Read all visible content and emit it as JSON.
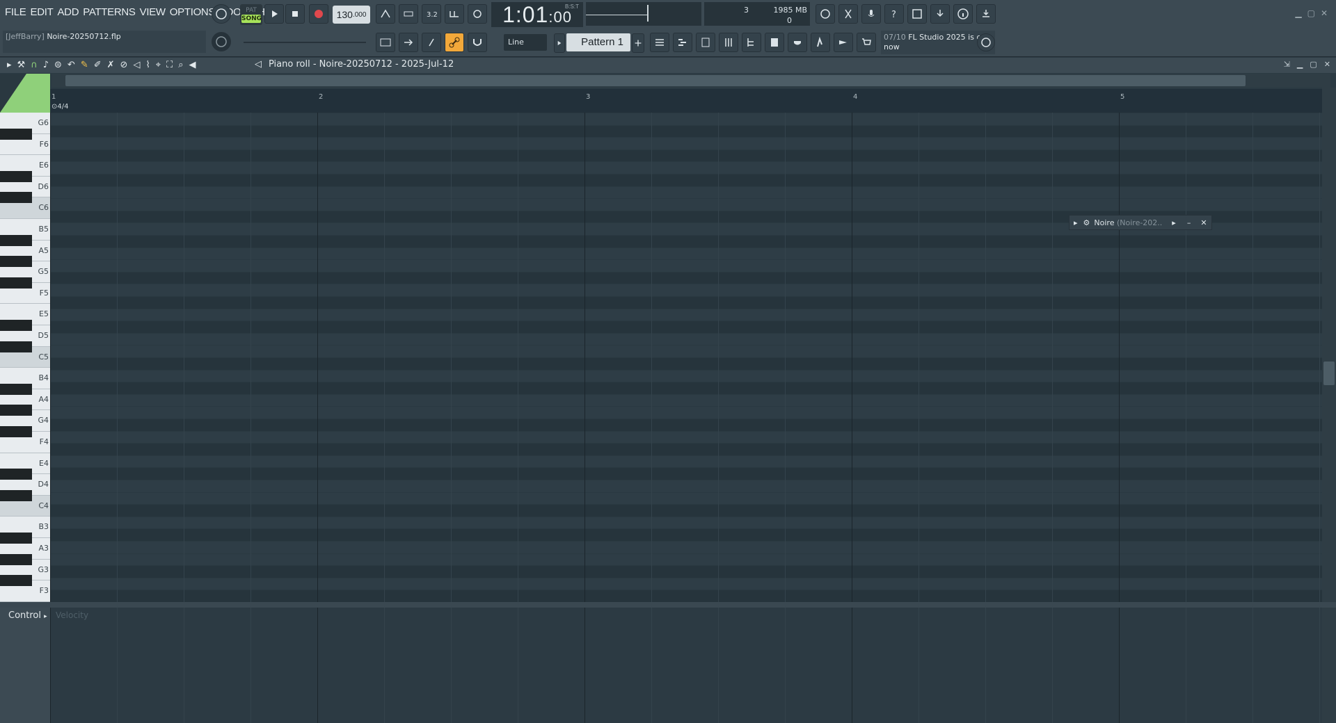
{
  "menu": [
    "FILE",
    "EDIT",
    "ADD",
    "PATTERNS",
    "VIEW",
    "OPTIONS",
    "TOOLS",
    "HELP"
  ],
  "transport": {
    "pat_label": "PAT",
    "song_label": "SONG",
    "tempo": "130",
    "tempo_frac": ".000"
  },
  "time_display": {
    "value": "1:01",
    "sub": ":00",
    "bst": "B:S:T"
  },
  "cpu": {
    "voices": "3",
    "memory": "1985 MB",
    "poly": "0"
  },
  "project": {
    "user": "[JeffBarry]",
    "file": "Noire-20250712.flp"
  },
  "snap_mode": "Line",
  "pattern_selector": "Pattern 1",
  "hint": {
    "date": "07/10",
    "text": "FL Studio 2025 is out now"
  },
  "piano_roll": {
    "title": "Piano roll - Noire-20250712 - 2025-Jul-12",
    "time_sig": "4/4"
  },
  "ruler_bars": [
    "1",
    "2",
    "3",
    "4",
    "5"
  ],
  "keys": [
    {
      "note": "G6",
      "type": "w"
    },
    {
      "note": "F6",
      "type": "w"
    },
    {
      "note": "E6",
      "type": "w"
    },
    {
      "note": "D6",
      "type": "w"
    },
    {
      "note": "C6",
      "type": "c"
    },
    {
      "note": "B5",
      "type": "w"
    },
    {
      "note": "A5",
      "type": "w"
    },
    {
      "note": "G5",
      "type": "w"
    },
    {
      "note": "F5",
      "type": "w"
    },
    {
      "note": "E5",
      "type": "w"
    },
    {
      "note": "D5",
      "type": "w"
    },
    {
      "note": "C5",
      "type": "c"
    },
    {
      "note": "B4",
      "type": "w"
    },
    {
      "note": "A4",
      "type": "w"
    },
    {
      "note": "G4",
      "type": "w"
    },
    {
      "note": "F4",
      "type": "w"
    },
    {
      "note": "E4",
      "type": "w"
    },
    {
      "note": "D4",
      "type": "w"
    },
    {
      "note": "C4",
      "type": "c"
    },
    {
      "note": "B3",
      "type": "w"
    },
    {
      "note": "A3",
      "type": "w"
    },
    {
      "note": "G3",
      "type": "w"
    },
    {
      "note": "F3",
      "type": "w"
    }
  ],
  "channel_window": {
    "name": "Noire",
    "sub": "(Noire-202.."
  },
  "control": {
    "label": "Control",
    "lane": "Velocity"
  }
}
